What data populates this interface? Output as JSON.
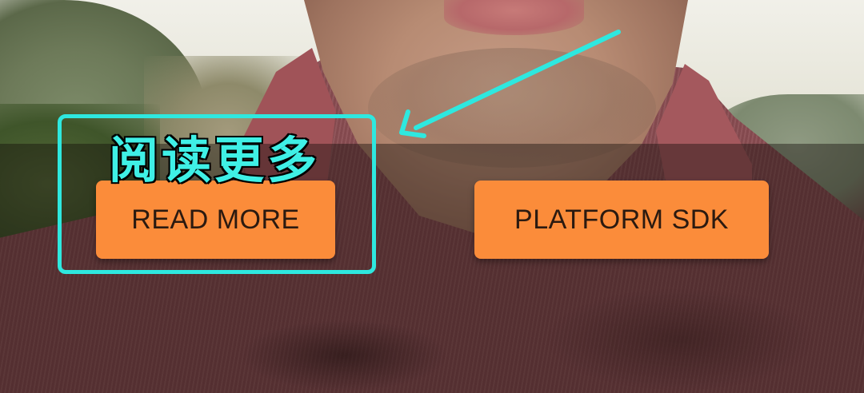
{
  "buttons": {
    "read_more": "READ MORE",
    "platform_sdk": "PLATFORM SDK"
  },
  "annotation": {
    "label": "阅读更多",
    "color": "#2ee8df"
  },
  "colors": {
    "button_background": "#fb8c3a",
    "button_text": "#2b1a10"
  },
  "icons": {
    "annotation_arrow": "arrow-icon"
  }
}
